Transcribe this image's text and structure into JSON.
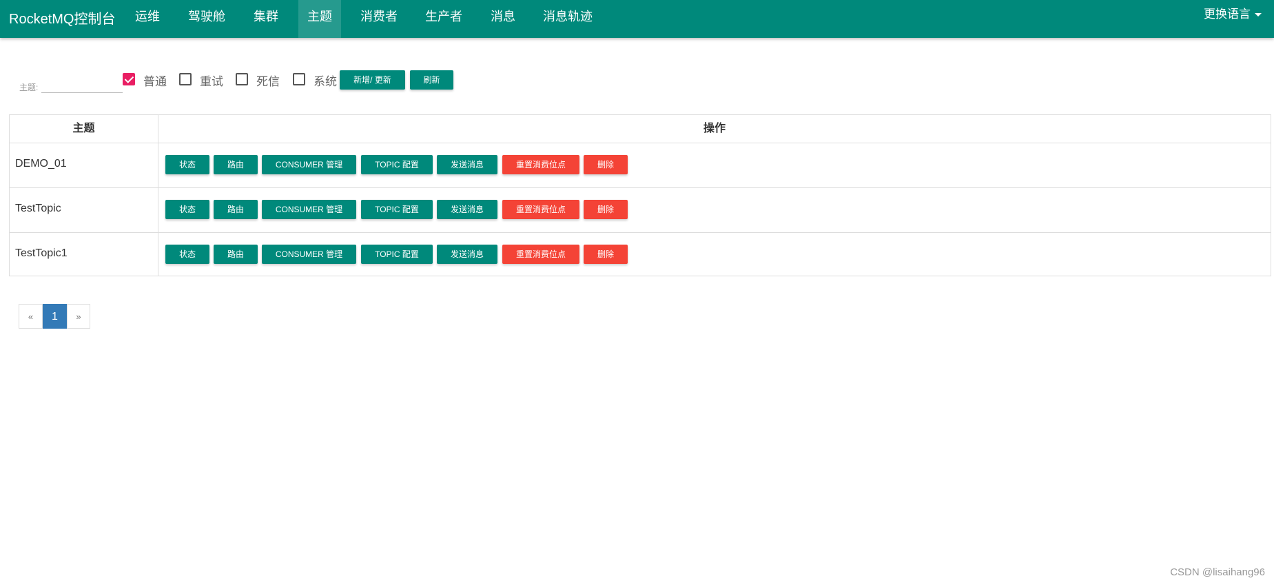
{
  "navbar": {
    "brand": "RocketMQ控制台",
    "items": [
      {
        "label": "运维"
      },
      {
        "label": "驾驶舱"
      },
      {
        "label": "集群"
      },
      {
        "label": "主题",
        "active": true
      },
      {
        "label": "消费者"
      },
      {
        "label": "生产者"
      },
      {
        "label": "消息"
      },
      {
        "label": "消息轨迹"
      }
    ],
    "language_label": "更换语言"
  },
  "filter": {
    "topic_label": "主题:",
    "topic_value": "",
    "checkboxes": [
      {
        "label": "普通",
        "checked": true
      },
      {
        "label": "重试",
        "checked": false
      },
      {
        "label": "死信",
        "checked": false
      },
      {
        "label": "系统",
        "checked": false
      }
    ],
    "add_update_label": "新增/ 更新",
    "refresh_label": "刷新"
  },
  "table": {
    "columns": [
      "主题",
      "操作"
    ],
    "actions": {
      "status": "状态",
      "route": "路由",
      "consumer_manage": "CONSUMER 管理",
      "topic_config": "TOPIC 配置",
      "send_message": "发送消息",
      "reset_offset": "重置消费位点",
      "delete": "删除"
    },
    "rows": [
      {
        "topic": "DEMO_01"
      },
      {
        "topic": "TestTopic"
      },
      {
        "topic": "TestTopic1"
      }
    ]
  },
  "pagination": {
    "prev": "«",
    "current": "1",
    "next": "»"
  },
  "watermark": "CSDN @lisaihang96",
  "colors": {
    "primary": "#00897b",
    "danger": "#f44336",
    "checkbox_checked": "#e91e63",
    "page_active": "#337ab7"
  }
}
